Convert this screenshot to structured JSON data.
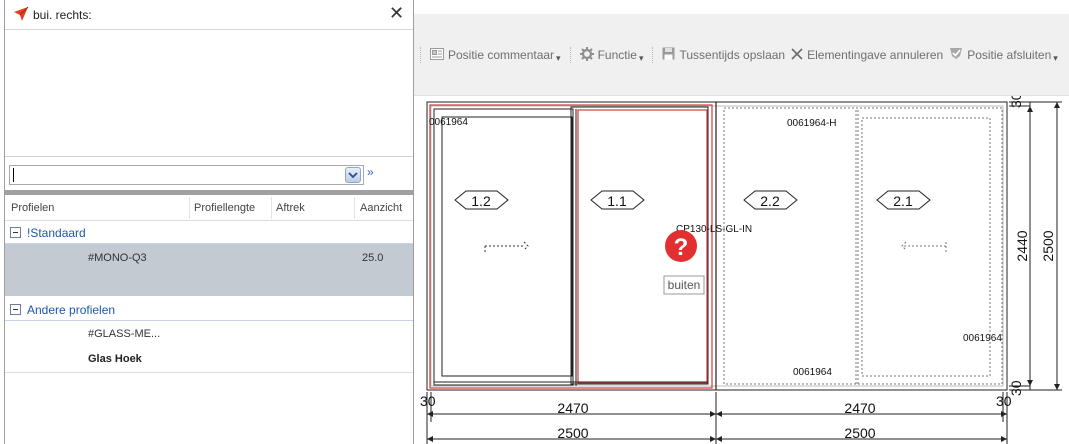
{
  "panel": {
    "title": "bui.  rechts:",
    "close_glyph": "✕",
    "expand_glyph": "»",
    "columns": [
      "Profielen",
      "Profiellengte",
      "Aftrek",
      "Aanzicht"
    ],
    "groups": [
      {
        "label": "!Standaard",
        "rows": [
          {
            "profile": "#MONO-Q3",
            "length": "",
            "deduction": "",
            "view": "25.0",
            "selected": true
          }
        ]
      },
      {
        "label": "Andere profielen",
        "rows": [
          {
            "profile": "#GLASS-ME...",
            "length": "",
            "deduction": "",
            "view": ""
          },
          {
            "profile": "Glas Hoek",
            "length": "",
            "deduction": "",
            "view": ""
          }
        ]
      }
    ]
  },
  "toolbar": {
    "position_comment": "Positie commentaar",
    "function": "Functie",
    "intermediate_save": "Tussentijds opslaan",
    "cancel_element": "Elementingave annuleren",
    "close_position": "Positie afsluiten"
  },
  "drawing": {
    "code_topleft": "0061964",
    "code_tophright": "0061964-H",
    "code_bottom": "0061964",
    "code_right": "0061964",
    "profile_label": "CP130-LS-GL-IN",
    "side_label": "buiten",
    "sash_labels": [
      "1.2",
      "1.1",
      "2.2",
      "2.1"
    ],
    "dims": {
      "left_30": "30",
      "right_30": "30",
      "inner_left": "2470",
      "inner_right": "2470",
      "outer_left": "2500",
      "outer_right": "2500",
      "height_inner": "2440",
      "height_outer": "2500",
      "top_30": "30",
      "bottom_30": "30"
    },
    "colors": {
      "selection": "#d33b3b",
      "warning": "#e23030"
    }
  }
}
